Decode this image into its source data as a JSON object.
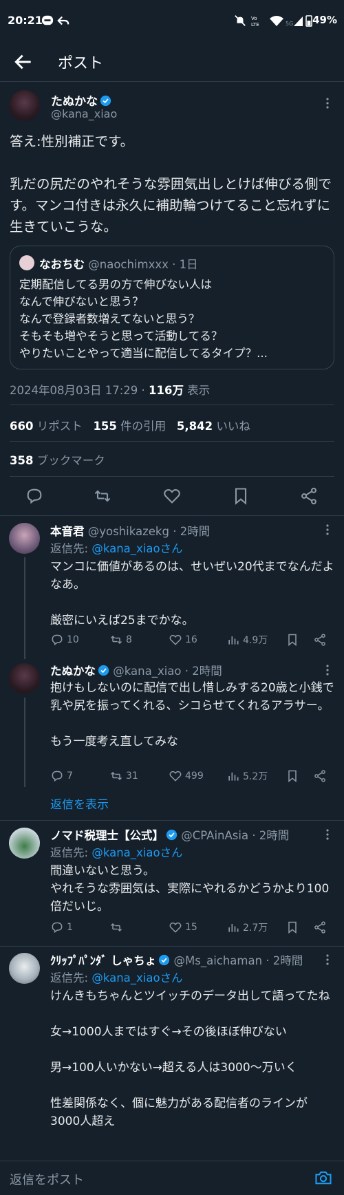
{
  "status_bar": {
    "time": "20:21",
    "battery": "49%"
  },
  "header": {
    "title": "ポスト"
  },
  "main_post": {
    "name": "たぬかな",
    "handle": "@kana_xiao",
    "text": "答え:性別補正です。\n\n乳だの尻だのやれそうな雰囲気出しとけば伸びる側です。マンコ付きは永久に補助輪つけてること忘れずに生きていこうな。",
    "quote": {
      "name": "なおちむ",
      "meta": "@naochimxxx · 1日",
      "text": "定期配信してる男の方で伸びない人は\nなんで伸びないと思う？\nなんで登録者数増えてないと思う？\nそもそも増やそうと思って活動してる？\nやりたいことやって適当に配信してるタイプ？..."
    },
    "timestamp": "2024年08月03日 17:29",
    "views_count": "116万",
    "views_label": "表示",
    "stats": {
      "reposts": "660",
      "reposts_label": "リポスト",
      "quotes": "155",
      "quotes_label": "件の引用",
      "likes": "5,842",
      "likes_label": "いいね",
      "bookmarks": "358",
      "bookmarks_label": "ブックマーク"
    }
  },
  "replies": [
    {
      "name": "本音君",
      "meta": "@yoshikazekg · 2時間",
      "reply_prefix": "返信先: ",
      "reply_to": "@kana_xiaoさん",
      "text": "マンコに価値があるのは、せいぜい20代までなんだよなあ。\n\n厳密にいえば25までかな。",
      "replies": "10",
      "reposts": "8",
      "likes": "16",
      "views": "4.9万"
    },
    {
      "name": "たぬかな",
      "meta": "@kana_xiao · 2時間",
      "text": "抱けもしないのに配信で出し惜しみする20歳と小銭で乳や尻を振ってくれる、シコらせてくれるアラサー。\n\nもう一度考え直してみな",
      "replies": "7",
      "reposts": "31",
      "likes": "499",
      "views": "5.2万",
      "show_replies": "返信を表示"
    },
    {
      "name": "ノマド税理士【公式】",
      "meta": "@CPAinAsia · 2時間",
      "reply_prefix": "返信先: ",
      "reply_to": "@kana_xiaoさん",
      "text": "間違いないと思う。\nやれそうな雰囲気は、実際にやれるかどうかより100倍だいじ。",
      "replies": "1",
      "reposts": "",
      "likes": "15",
      "views": "2.7万"
    },
    {
      "name": "ｸﾘｯﾌﾟﾊﾟﾝﾀﾞ しゃちょ",
      "meta": "@Ms_aichaman · 2時間",
      "reply_prefix": "返信先: ",
      "reply_to": "@kana_xiaoさん",
      "text": "けんきもちゃんとツイッチのデータ出して語ってたね\n\n女→1000人まではすぐ→その後ほぼ伸びない\n\n男→100人いかない→超える人は3000〜万いく\n\n性差関係なく、個に魅力がある配信者のラインが3000人超え"
    }
  ],
  "composer": {
    "placeholder": "返信をポスト"
  },
  "colors": {
    "background": "#15202b",
    "accent": "#1d9bf0",
    "text": "#e7e9ea",
    "muted": "#8b98a5"
  }
}
